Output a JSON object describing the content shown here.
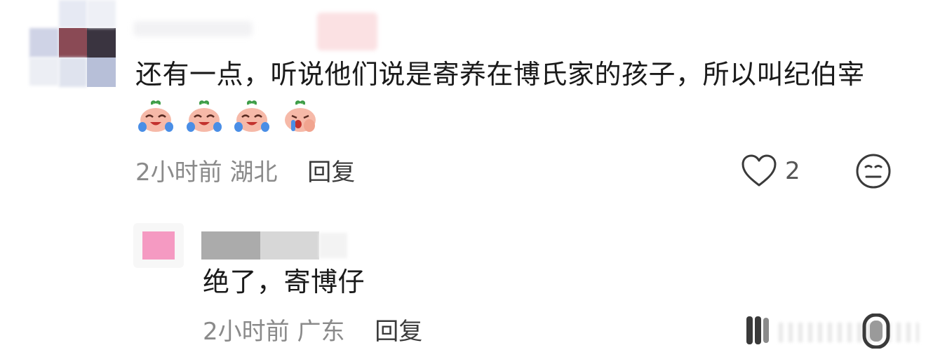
{
  "comment": {
    "text": "还有一点，听说他们说是寄养在博氏家的孩子，所以叫纪伯宰",
    "emojis": [
      "crying-laughing-sprout-emoji",
      "crying-laughing-sprout-emoji",
      "crying-laughing-sprout-emoji",
      "crying-face-sprout-emoji"
    ],
    "time": "2小时前",
    "location": "湖北",
    "reply_label": "回复",
    "like_count": "2"
  },
  "reply": {
    "text": "绝了，寄博仔",
    "time": "2小时前",
    "location": "广东",
    "reply_label": "回复"
  },
  "colors": {
    "avatar_reply": "#f59ac2",
    "meta_text": "#8a8a8a",
    "body_text": "#1a1a1a"
  }
}
